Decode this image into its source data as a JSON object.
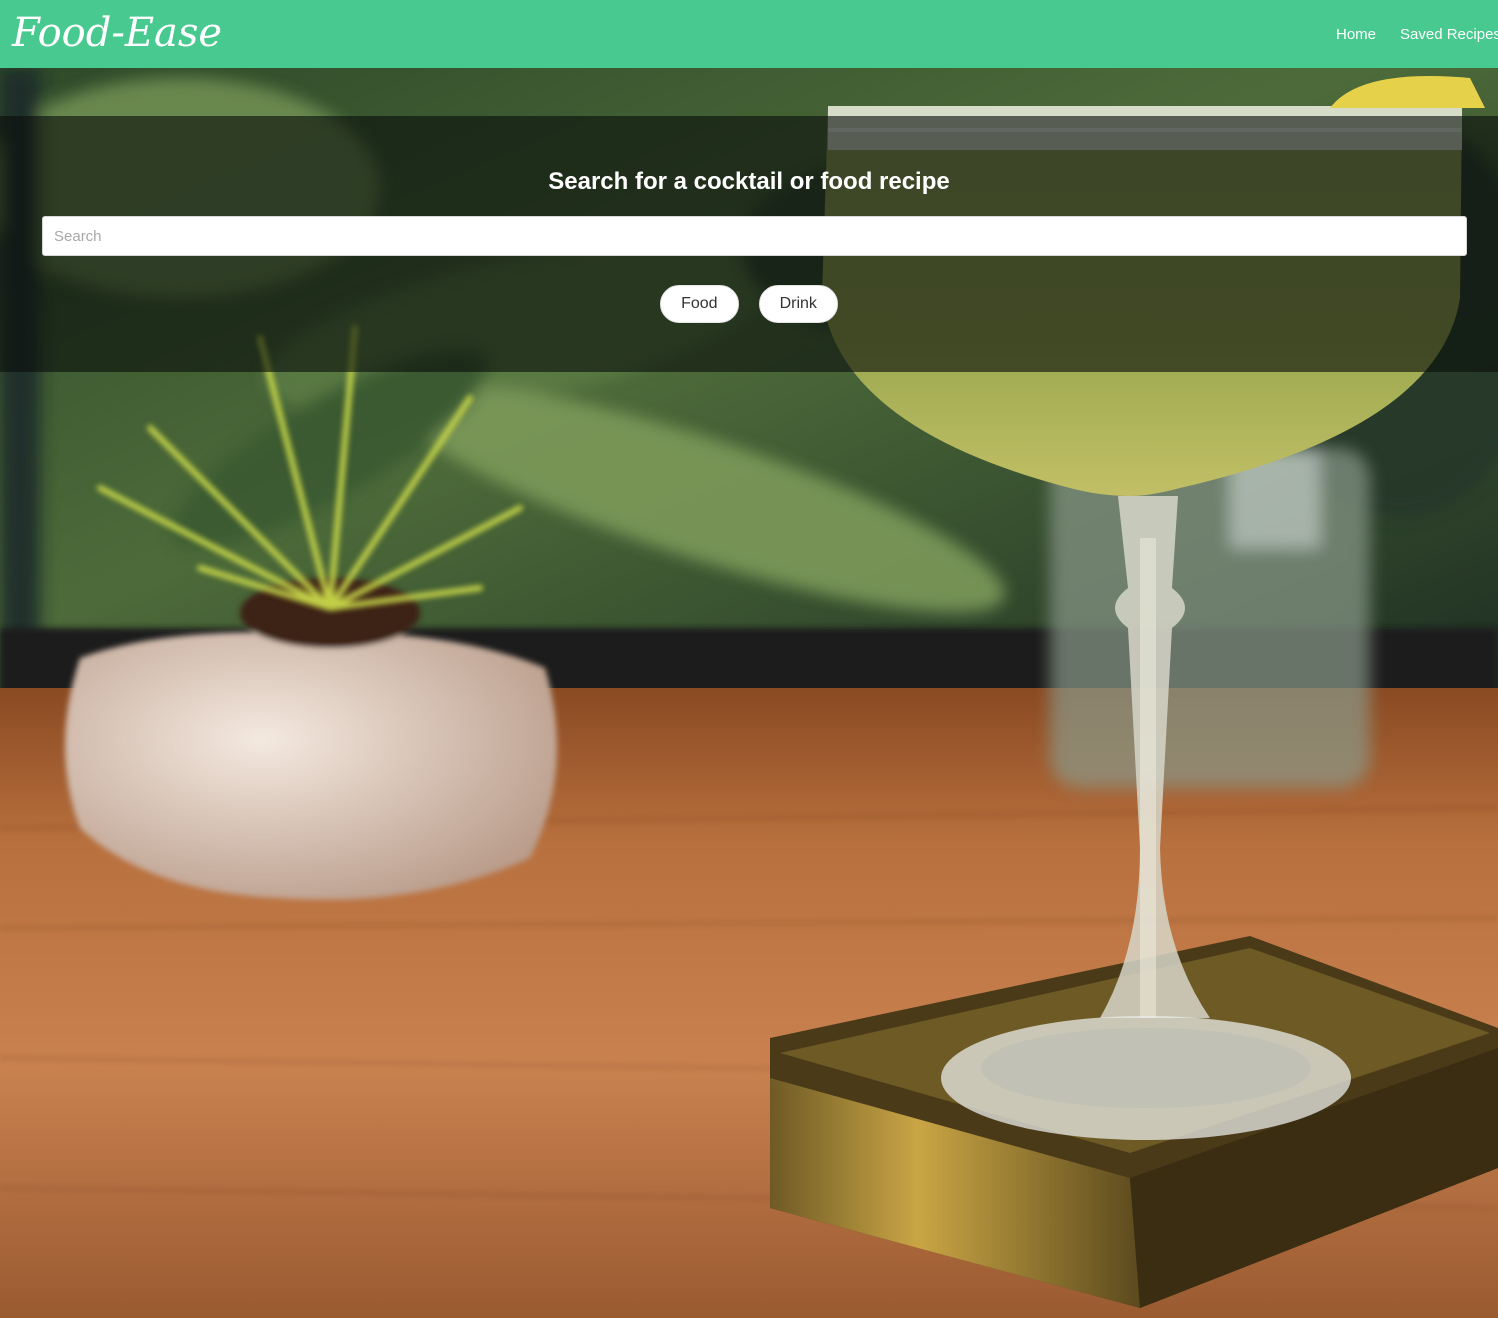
{
  "nav": {
    "brand": "Food-Ease",
    "links": [
      {
        "label": "Home"
      },
      {
        "label": "Saved Recipes"
      }
    ]
  },
  "search": {
    "heading": "Search for a cocktail or food recipe",
    "placeholder": "Search",
    "value": "",
    "buttons": [
      {
        "label": "Food"
      },
      {
        "label": "Drink"
      }
    ]
  },
  "background": {
    "subject": "cocktail-glass-photo",
    "colors": {
      "navbar": "#48c98f",
      "wood_table": "#b5683a",
      "foliage": "#3f5a2f",
      "drink": "#9aa850",
      "tray": "#a8893a"
    }
  }
}
